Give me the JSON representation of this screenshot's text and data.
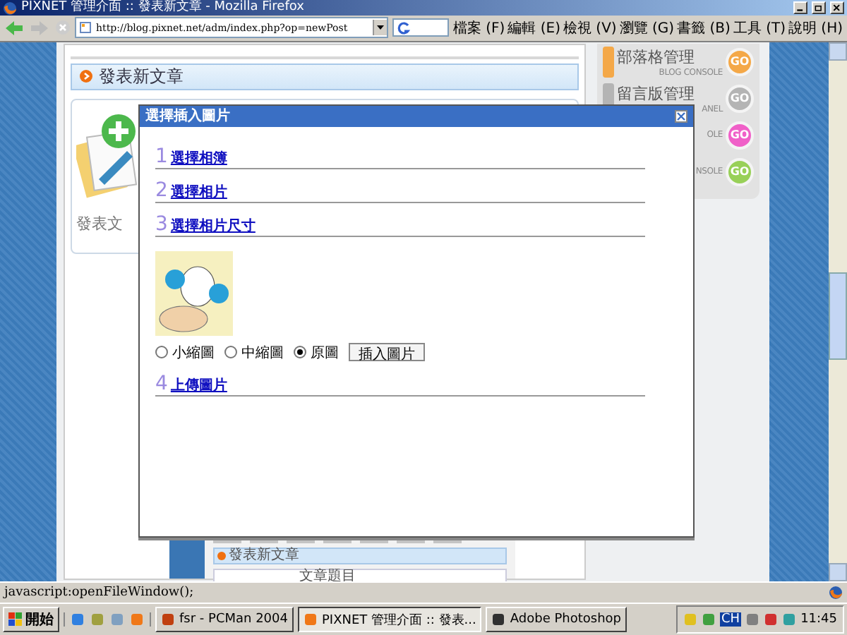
{
  "window": {
    "title": "PIXNET 管理介面 :: 發表新文章 - Mozilla Firefox"
  },
  "toolbar": {
    "address": "http://blog.pixnet.net/adm/index.php?op=newPost"
  },
  "menu": [
    "檔案 (F)",
    "編輯 (E)",
    "檢視 (V)",
    "瀏覽 (G)",
    "書籤 (B)",
    "工具 (T)",
    "說明 (H)"
  ],
  "page": {
    "header": "發表新文章",
    "new_post_label": "發表文",
    "console": [
      {
        "title": "部落格管理",
        "subtitle": "BLOG CONSOLE",
        "go": "GO",
        "color": "#f4a848"
      },
      {
        "title": "留言版管理",
        "subtitle": "ANEL",
        "go": "GO",
        "color": "#b4b4b4"
      },
      {
        "subtitle": "OLE",
        "go": "GO",
        "color": "#f060c8"
      },
      {
        "subtitle": "NSOLE",
        "go": "GO",
        "color": "#98d058"
      }
    ],
    "preview": {
      "header": "發表新文章",
      "field_label": "文章題目"
    }
  },
  "dialog": {
    "title": "選擇插入圖片",
    "steps": [
      {
        "number": "1",
        "label": "選擇相簿"
      },
      {
        "number": "2",
        "label": "選擇相片"
      },
      {
        "number": "3",
        "label": "選擇相片尺寸",
        "size_options": [
          {
            "label": "小縮圖",
            "selected": false
          },
          {
            "label": "中縮圖",
            "selected": false
          },
          {
            "label": "原圖",
            "selected": true
          }
        ],
        "insert_button": "插入圖片"
      },
      {
        "number": "4",
        "label": "上傳圖片"
      }
    ]
  },
  "status_bar": {
    "text": "javascript:openFileWindow();"
  },
  "taskbar": {
    "start": "開始",
    "tasks": [
      {
        "label": "fsr - PCMan 2004",
        "selected": false
      },
      {
        "label": "PIXNET 管理介面 :: 發表...",
        "selected": true
      },
      {
        "label": "Adobe Photoshop",
        "selected": false
      }
    ],
    "tray_language": "CH",
    "clock": "11:45"
  }
}
